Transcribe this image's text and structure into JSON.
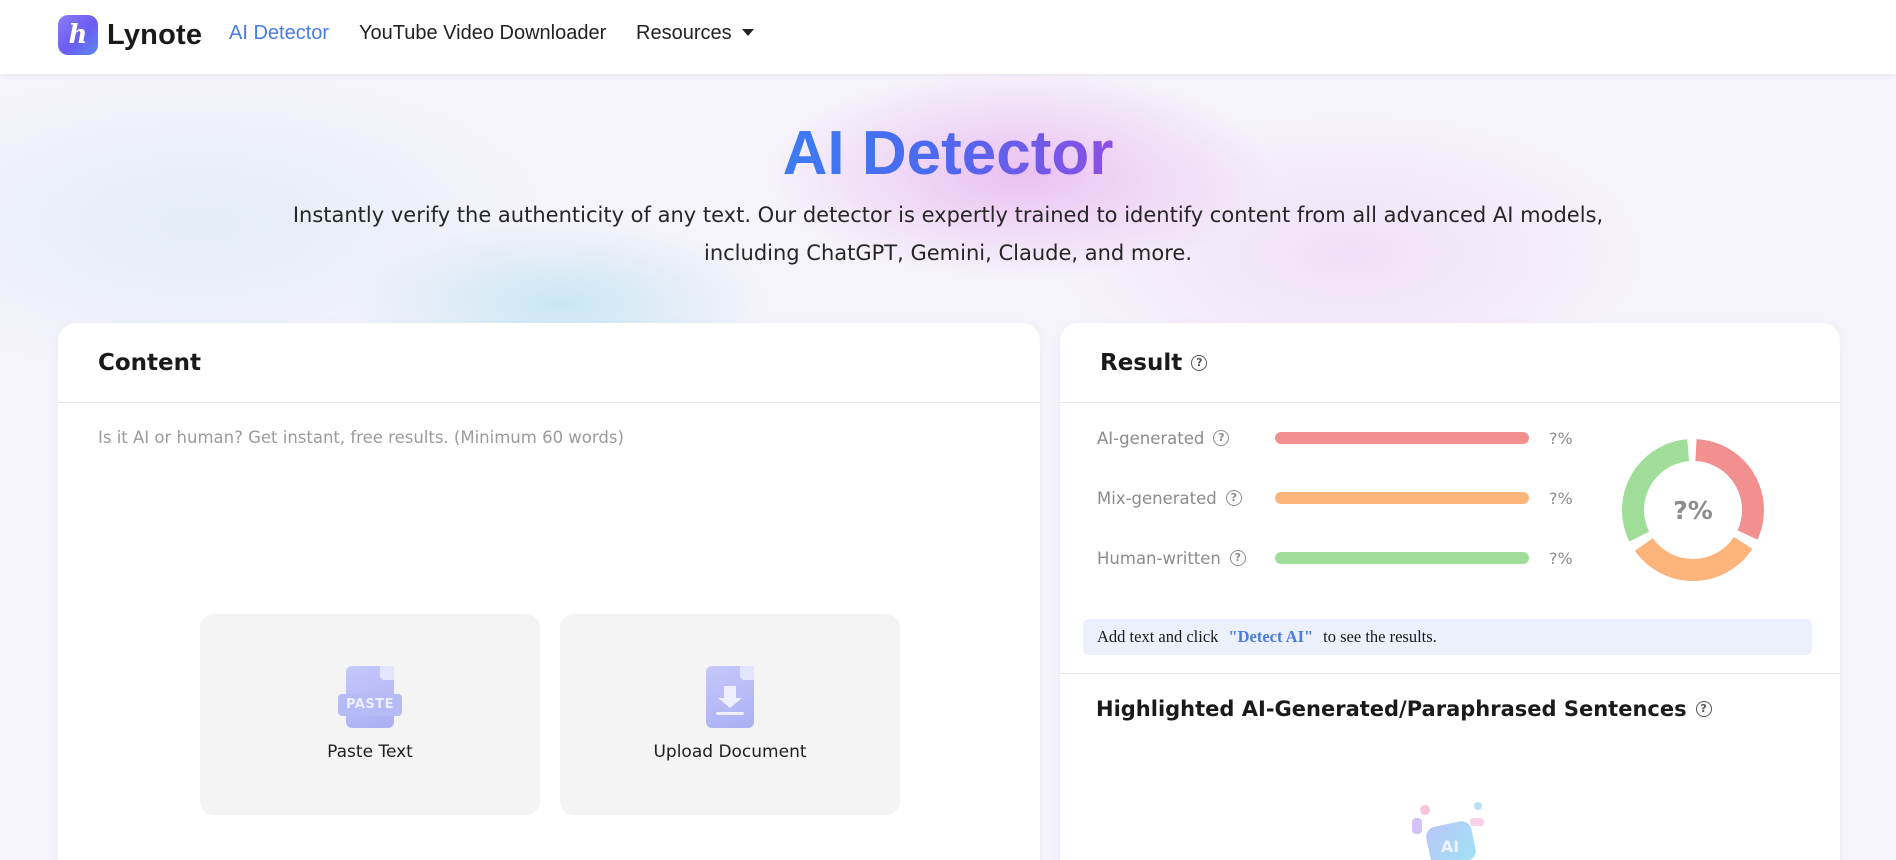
{
  "nav": {
    "brand": "Lynote",
    "links": {
      "ai_detector": "AI Detector",
      "youtube_downloader": "YouTube Video Downloader",
      "resources": "Resources"
    }
  },
  "hero": {
    "title": "AI Detector",
    "subtitle": "Instantly verify the authenticity of any text. Our detector is expertly trained to identify content from all advanced AI models, including ChatGPT, Gemini, Claude, and more."
  },
  "content": {
    "title": "Content",
    "placeholder": "Is it AI or human? Get instant, free results. (Minimum 60 words)",
    "actions": {
      "paste_label": "Paste Text",
      "paste_icon_text": "PASTE",
      "upload_label": "Upload Document"
    }
  },
  "result": {
    "title": "Result",
    "rows": [
      {
        "label": "AI-generated",
        "value": "?%",
        "color": "#f29090"
      },
      {
        "label": "Mix-generated",
        "value": "?%",
        "color": "#fdb47a"
      },
      {
        "label": "Human-written",
        "value": "?%",
        "color": "#9fdd98"
      }
    ],
    "donut_center": "?%",
    "notice": {
      "prefix": "Add text and click",
      "keyword": "\"Detect AI\"",
      "suffix": "to see the results."
    },
    "highlight_title": "Highlighted AI-Generated/Paraphrased Sentences",
    "illustration_text": "AI"
  },
  "colors": {
    "accent": "#4a7be0",
    "ai": "#f29090",
    "mix": "#fdb47a",
    "human": "#9fdd98"
  }
}
